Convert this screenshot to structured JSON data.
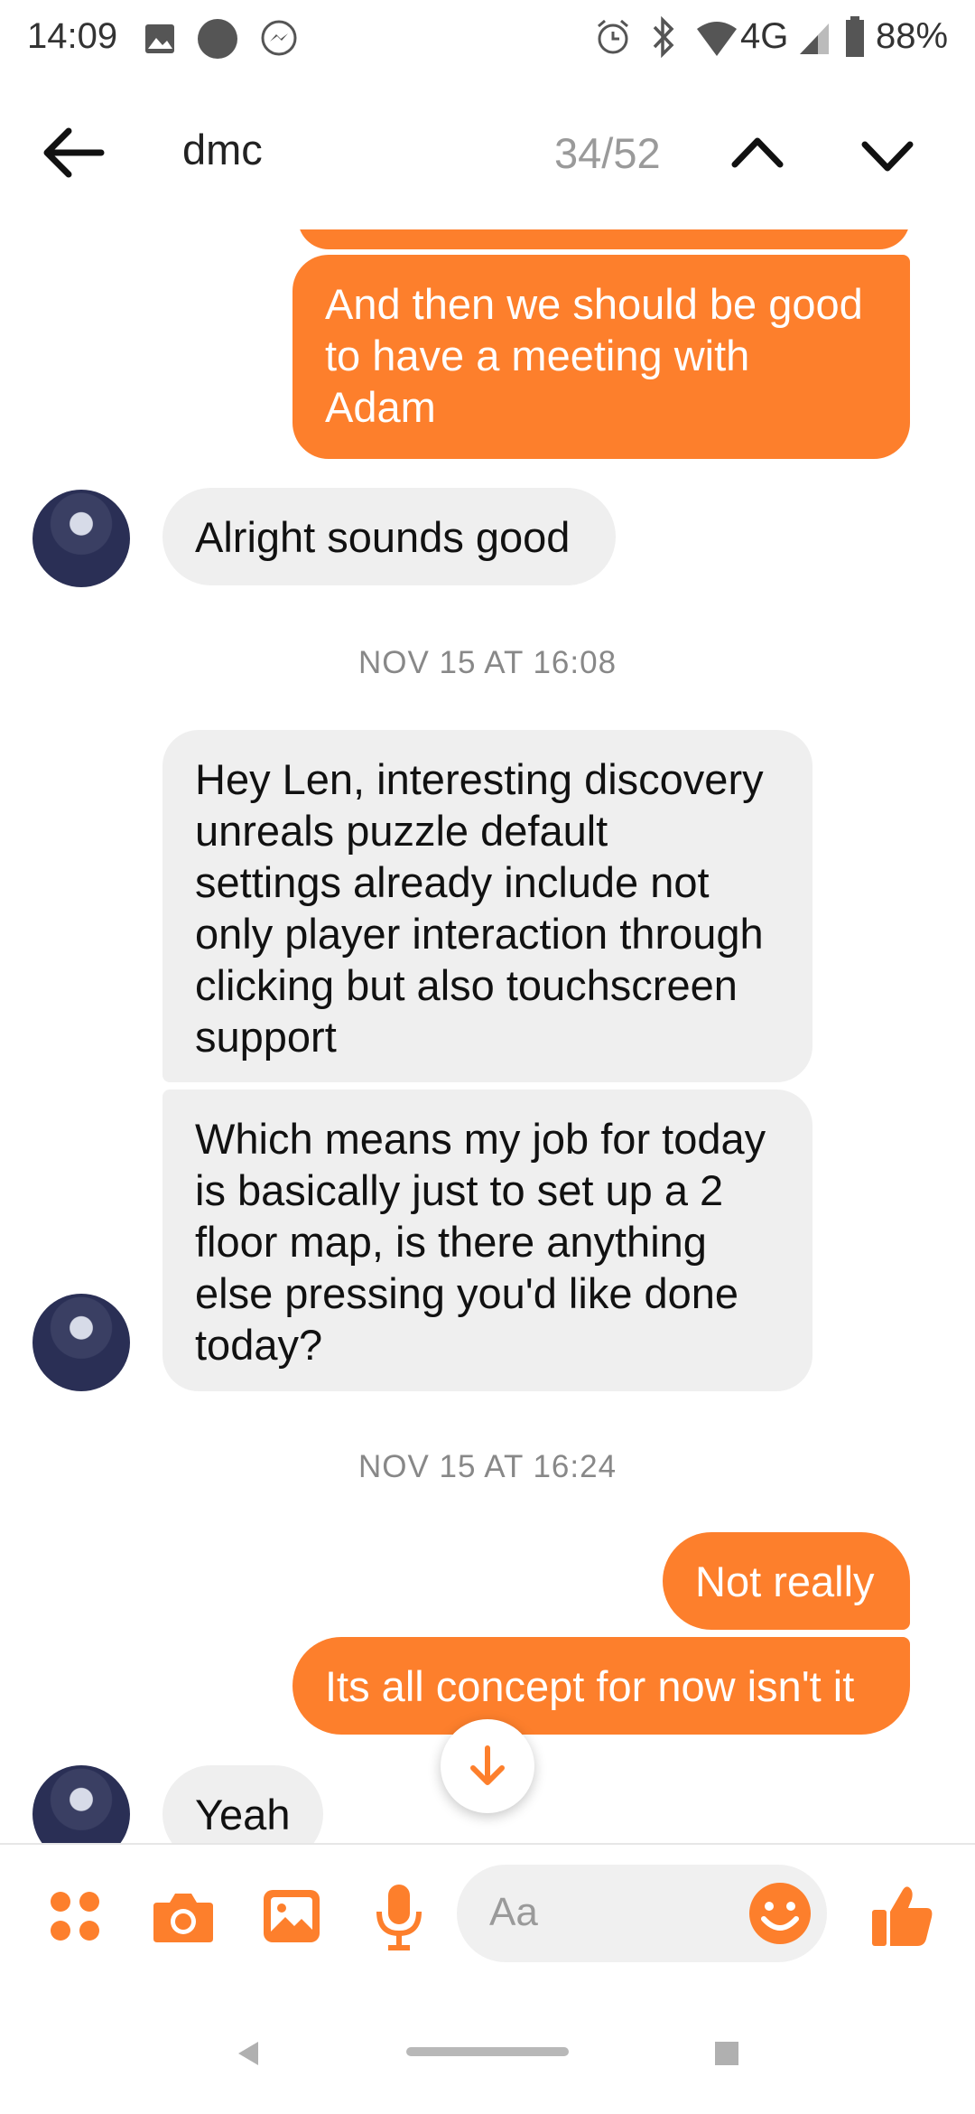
{
  "status_bar": {
    "time": "14:09",
    "network": "4G",
    "battery": "88%",
    "icons": [
      "image-icon",
      "dot-icon",
      "messenger-icon",
      "alarm-icon",
      "bluetooth-icon",
      "wifi-icon",
      "signal-icon",
      "battery-icon"
    ]
  },
  "header": {
    "title": "dmc",
    "search_counter": "34/52",
    "icons": [
      "back-arrow-icon",
      "chevron-up-icon",
      "chevron-down-icon"
    ]
  },
  "messages": [
    {
      "id": "m1",
      "direction": "outgoing",
      "lines": [
        "And then we should be good",
        "to have a meeting with",
        "Adam"
      ]
    },
    {
      "id": "m2",
      "direction": "incoming",
      "lines": [
        "Alright sounds good"
      ]
    },
    {
      "id": "t1",
      "type": "timestamp",
      "text": "NOV 15 AT 16:08"
    },
    {
      "id": "m3",
      "direction": "incoming",
      "lines": [
        "Hey Len, interesting discovery",
        "unreals puzzle default",
        "settings already include not",
        "only player interaction through",
        "clicking but also touchscreen",
        "support"
      ]
    },
    {
      "id": "m4",
      "direction": "incoming",
      "lines": [
        "Which means my job for today",
        "is basically just to set up a 2",
        "floor map, is there anything",
        "else pressing you'd like done",
        "today?"
      ]
    },
    {
      "id": "t2",
      "type": "timestamp",
      "text": "NOV 15 AT 16:24"
    },
    {
      "id": "m5",
      "direction": "outgoing",
      "lines": [
        "Not really"
      ]
    },
    {
      "id": "m6",
      "direction": "outgoing",
      "lines": [
        "Its all concept for now isn't it"
      ]
    },
    {
      "id": "m7",
      "direction": "incoming",
      "lines": [
        "Yeah"
      ]
    }
  ],
  "composer": {
    "placeholder": "Aa",
    "icons": [
      "apps-icon",
      "camera-icon",
      "gallery-icon",
      "microphone-icon",
      "emoji-icon",
      "thumbs-up-icon"
    ]
  },
  "colors": {
    "accent": "#fd7f2c",
    "incoming_bubble": "#efefef",
    "timestamp": "#888888"
  }
}
